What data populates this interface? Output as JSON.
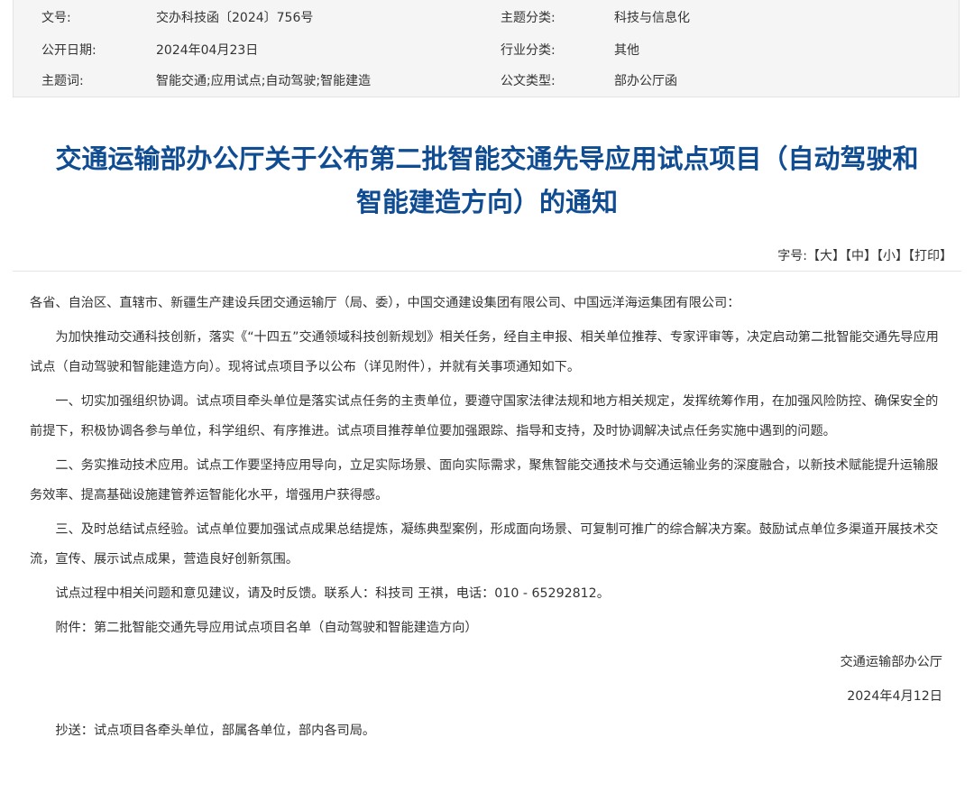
{
  "meta": {
    "rows": [
      {
        "label1": "文号:",
        "value1": "交办科技函〔2024〕756号",
        "label2": "主题分类:",
        "value2": "科技与信息化"
      },
      {
        "label1": "公开日期:",
        "value1": "2024年04月23日",
        "label2": "行业分类:",
        "value2": "其他"
      },
      {
        "label1": "主题词:",
        "value1": "智能交通;应用试点;自动驾驶;智能建造",
        "label2": "公文类型:",
        "value2": "部办公厅函"
      }
    ]
  },
  "title": {
    "line1": "交通运输部办公厅关于公布第二批智能交通先导应用试点项目（自动驾驶和",
    "line2": "智能建造方向）的通知"
  },
  "font_tools": {
    "label": "字号:",
    "large": "【大】",
    "medium": "【中】",
    "small": "【小】",
    "print": "【打印】"
  },
  "body": {
    "salutation": "各省、自治区、直辖市、新疆生产建设兵团交通运输厅（局、委），中国交通建设集团有限公司、中国远洋海运集团有限公司：",
    "p1": "为加快推动交通科技创新，落实《“十四五”交通领域科技创新规划》相关任务，经自主申报、相关单位推荐、专家评审等，决定启动第二批智能交通先导应用试点（自动驾驶和智能建造方向）。现将试点项目予以公布（详见附件），并就有关事项通知如下。",
    "p2": "一、切实加强组织协调。试点项目牵头单位是落实试点任务的主责单位，要遵守国家法律法规和地方相关规定，发挥统筹作用，在加强风险防控、确保安全的前提下，积极协调各参与单位，科学组织、有序推进。试点项目推荐单位要加强跟踪、指导和支持，及时协调解决试点任务实施中遇到的问题。",
    "p3": "二、务实推动技术应用。试点工作要坚持应用导向，立足实际场景、面向实际需求，聚焦智能交通技术与交通运输业务的深度融合，以新技术赋能提升运输服务效率、提高基础设施建管养运智能化水平，增强用户获得感。",
    "p4": "三、及时总结试点经验。试点单位要加强试点成果总结提炼，凝练典型案例，形成面向场景、可复制可推广的综合解决方案。鼓励试点单位多渠道开展技术交流，宣传、展示试点成果，营造良好创新氛围。",
    "p5": "试点过程中相关问题和意见建议，请及时反馈。联系人：科技司 王祺，电话：010 - 65292812。",
    "attachment": "附件：第二批智能交通先导应用试点项目名单（自动驾驶和智能建造方向）",
    "sign_org": "交通运输部办公厅",
    "sign_date": "2024年4月12日",
    "cc": "抄送：试点项目各牵头单位，部属各单位，部内各司局。"
  }
}
